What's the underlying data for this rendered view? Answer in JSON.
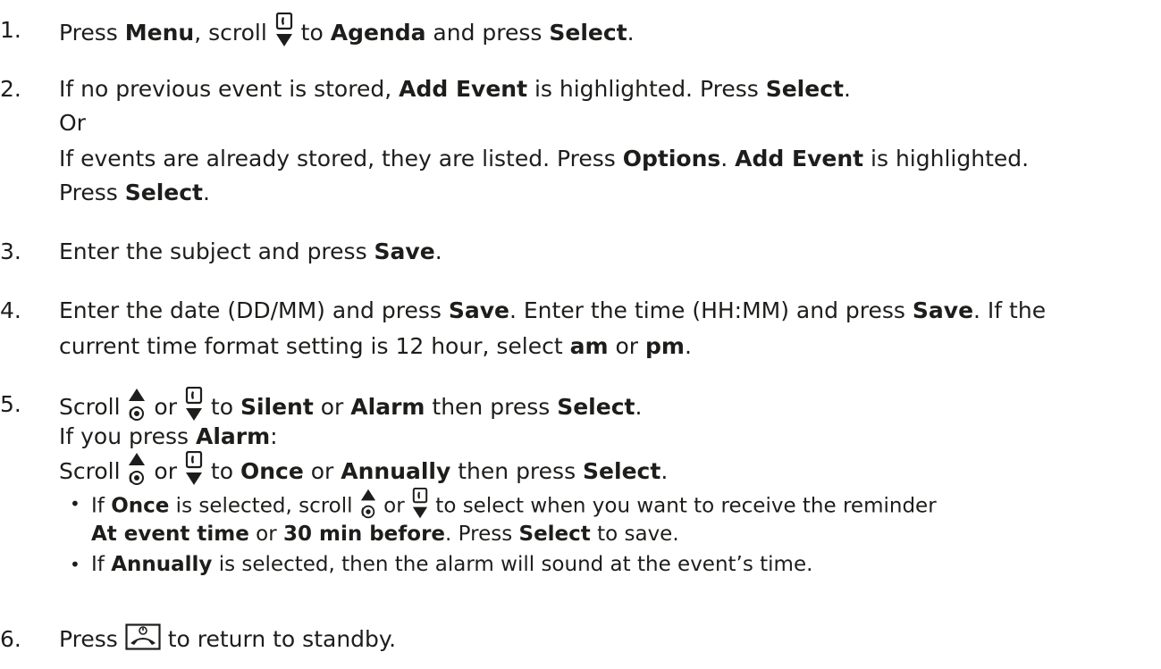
{
  "steps": [
    {
      "num": "1.",
      "l1_a": "Press ",
      "l1_menu": "Menu",
      "l1_b": ", scroll ",
      "l1_c": " to ",
      "l1_agenda": "Agenda",
      "l1_d": " and press ",
      "l1_select": "Select",
      "l1_e": "."
    },
    {
      "num": "2.",
      "l1_a": "If no previous event is stored, ",
      "l1_add": "Add Event",
      "l1_b": " is highlighted. Press ",
      "l1_select": "Select",
      "l1_c": ".",
      "or": "Or",
      "l3_a": "If events are already stored, they are listed. Press ",
      "l3_options": "Options",
      "l3_b": ". ",
      "l3_add": "Add Event",
      "l3_c": " is highlighted.",
      "l4_a": "Press ",
      "l4_select": "Select",
      "l4_b": "."
    },
    {
      "num": "3.",
      "l1_a": "Enter the subject and press ",
      "l1_save": "Save",
      "l1_b": "."
    },
    {
      "num": "4.",
      "l1_a": "Enter the date (DD/MM) and press ",
      "l1_save": "Save",
      "l1_b": ". Enter the time (HH:MM) and press ",
      "l1_save2": "Save",
      "l1_c": ". If the",
      "l2_a": "current time format setting is 12 hour, select ",
      "l2_am": "am",
      "l2_b": " or ",
      "l2_pm": "pm",
      "l2_c": "."
    },
    {
      "num": "5.",
      "l1_a": "Scroll ",
      "l1_or": " or ",
      "l1_b": " to ",
      "l1_silent": "Silent",
      "l1_c": " or ",
      "l1_alarm": "Alarm",
      "l1_d": " then press ",
      "l1_select": "Select",
      "l1_e": ".",
      "l2_a": "If you press ",
      "l2_alarm": "Alarm",
      "l2_b": ":",
      "l3_a": "Scroll ",
      "l3_or": " or ",
      "l3_b": " to ",
      "l3_once": "Once",
      "l3_c": " or ",
      "l3_annually": "Annually",
      "l3_d": " then press ",
      "l3_select": "Select",
      "l3_e": ".",
      "bullets": [
        {
          "a": "If ",
          "once": "Once",
          "b": " is selected, scroll ",
          "or": " or ",
          "c": " to select when you want to receive the reminder",
          "l2_at": "At event time",
          "l2_or": " or ",
          "l2_30": "30 min before",
          "l2_a": ". Press ",
          "l2_select": "Select",
          "l2_b": " to save."
        },
        {
          "a": "If ",
          "annually": "Annually",
          "b": " is selected, then the alarm will sound at the event’s time."
        }
      ]
    },
    {
      "num": "6.",
      "l1_a": "Press ",
      "l1_b": " to return to standby."
    }
  ],
  "icons": [
    "scroll-down-icon",
    "scroll-up-icon",
    "end-call-icon"
  ]
}
